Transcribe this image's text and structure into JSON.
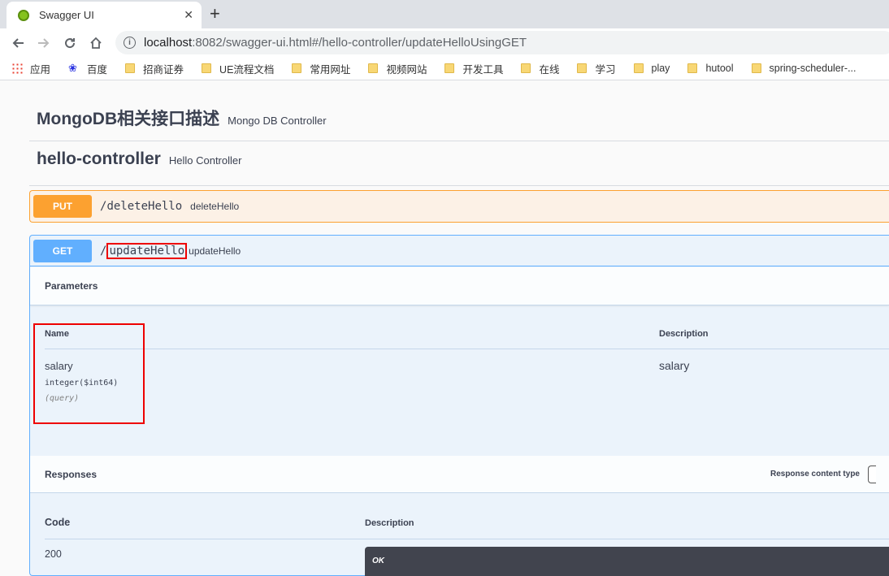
{
  "browser": {
    "tab_title": "Swagger UI",
    "tab_close": "✕",
    "new_tab": "+",
    "url_host": "localhost",
    "url_rest": ":8082/swagger-ui.html#/hello-controller/updateHelloUsingGET",
    "bookmarks": [
      "应用",
      "百度",
      "招商证券",
      "UE流程文档",
      "常用网址",
      "视频网站",
      "开发工具",
      "在线",
      "学习",
      "play",
      "hutool",
      "spring-scheduler-..."
    ]
  },
  "tags": [
    {
      "name": "MongoDB相关接口描述",
      "description": "Mongo DB Controller"
    },
    {
      "name": "hello-controller",
      "description": "Hello Controller"
    }
  ],
  "operations": [
    {
      "method": "PUT",
      "path_prefix": "/",
      "path_name": "deleteHello",
      "summary": "deleteHello",
      "color": "#fca130"
    },
    {
      "method": "GET",
      "path_prefix": "/",
      "path_name": "updateHello",
      "summary": "updateHello",
      "color": "#61affe"
    }
  ],
  "parameters": {
    "title": "Parameters",
    "col_name": "Name",
    "col_description": "Description",
    "rows": [
      {
        "name": "salary",
        "type": "integer($int64)",
        "in": "(query)",
        "description": "salary"
      }
    ]
  },
  "responses": {
    "title": "Responses",
    "content_type_label": "Response content type",
    "col_code": "Code",
    "col_description": "Description",
    "rows": [
      {
        "code": "200",
        "description": "OK"
      }
    ]
  }
}
